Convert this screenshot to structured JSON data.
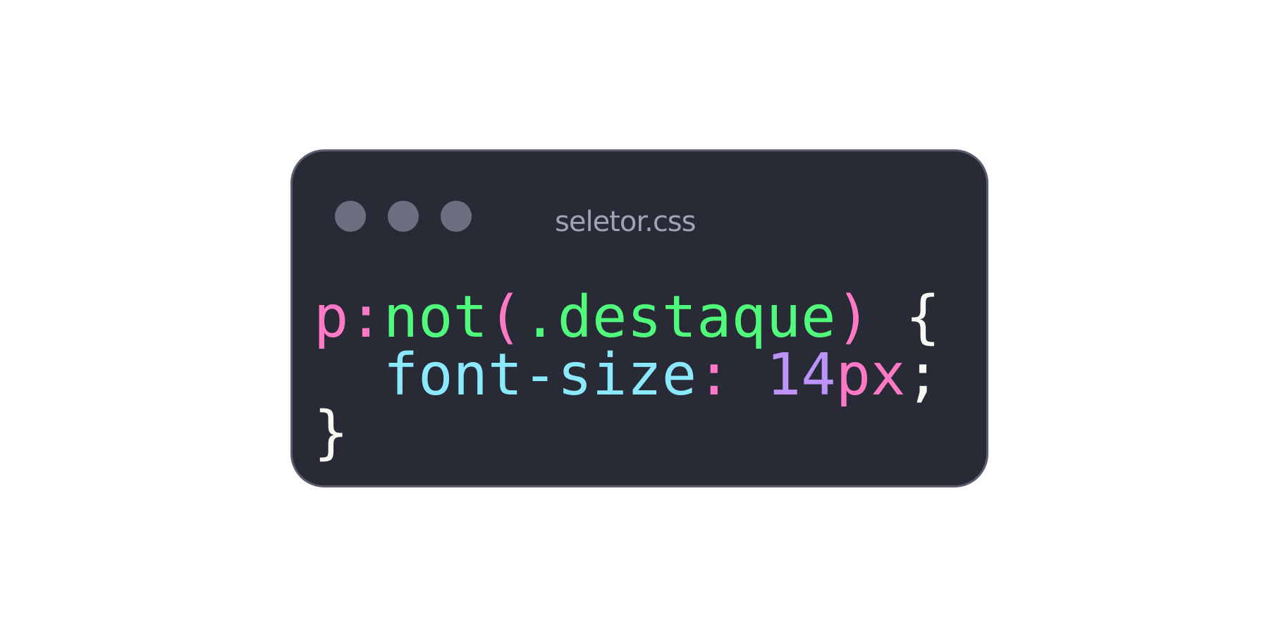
{
  "window": {
    "filename": "seletor.css",
    "dot_color": "#6c6f80",
    "background_color": "#282a36"
  },
  "code": {
    "line1": {
      "selector_element": "p",
      "pseudo_colon": ":",
      "pseudo_class": "not",
      "paren_open": "(",
      "argument": ".destaque",
      "paren_close": ")",
      "brace_open": "{"
    },
    "line2": {
      "property": "font-size",
      "colon": ":",
      "number": "14",
      "unit": "px",
      "semicolon": ";"
    },
    "line3": {
      "brace_close": "}"
    }
  },
  "colors": {
    "pink": "#ff79c6",
    "green": "#50fa7b",
    "cyan": "#8be9fd",
    "purple": "#bd93f9",
    "white": "#f8f8f2"
  }
}
